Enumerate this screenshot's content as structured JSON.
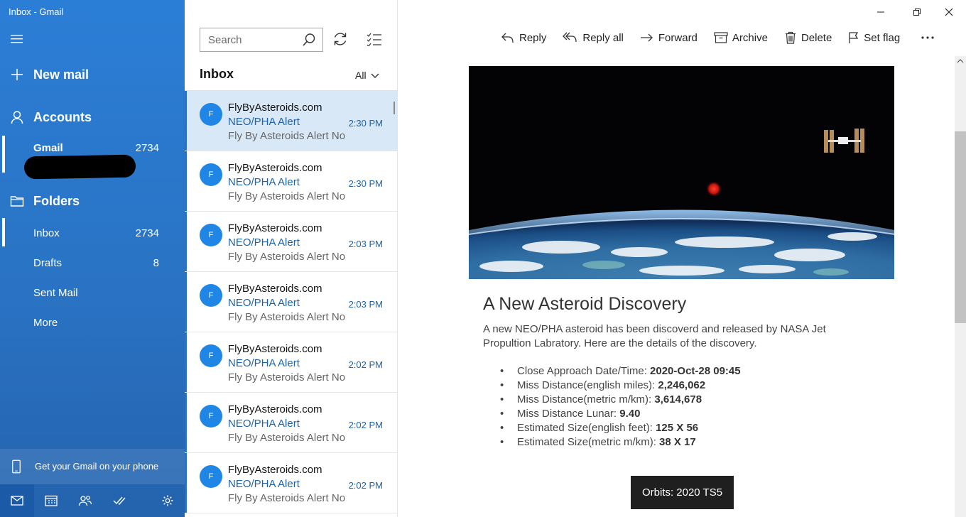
{
  "window": {
    "title": "Inbox - Gmail"
  },
  "nav": {
    "new_mail": "New mail",
    "accounts": "Accounts",
    "account": {
      "name": "Gmail",
      "count": "2734"
    },
    "folders_label": "Folders",
    "folders": [
      {
        "label": "Inbox",
        "count": "2734"
      },
      {
        "label": "Drafts",
        "count": "8"
      },
      {
        "label": "Sent Mail",
        "count": ""
      },
      {
        "label": "More",
        "count": ""
      }
    ],
    "phone_promo": "Get your Gmail on your phone"
  },
  "list": {
    "search_placeholder": "Search",
    "title": "Inbox",
    "filter": "All",
    "messages": [
      {
        "avatar": "F",
        "from": "FlyByAsteroids.com",
        "subject": "NEO/PHA Alert",
        "time": "2:30 PM",
        "preview": "Fly By Asteroids Alert No"
      },
      {
        "avatar": "F",
        "from": "FlyByAsteroids.com",
        "subject": "NEO/PHA Alert",
        "time": "2:30 PM",
        "preview": "Fly By Asteroids Alert No"
      },
      {
        "avatar": "F",
        "from": "FlyByAsteroids.com",
        "subject": "NEO/PHA Alert",
        "time": "2:03 PM",
        "preview": "Fly By Asteroids Alert No"
      },
      {
        "avatar": "F",
        "from": "FlyByAsteroids.com",
        "subject": "NEO/PHA Alert",
        "time": "2:03 PM",
        "preview": "Fly By Asteroids Alert No"
      },
      {
        "avatar": "F",
        "from": "FlyByAsteroids.com",
        "subject": "NEO/PHA Alert",
        "time": "2:02 PM",
        "preview": "Fly By Asteroids Alert No"
      },
      {
        "avatar": "F",
        "from": "FlyByAsteroids.com",
        "subject": "NEO/PHA Alert",
        "time": "2:02 PM",
        "preview": "Fly By Asteroids Alert No"
      },
      {
        "avatar": "F",
        "from": "FlyByAsteroids.com",
        "subject": "NEO/PHA Alert",
        "time": "2:02 PM",
        "preview": "Fly By Asteroids Alert No"
      }
    ]
  },
  "toolbar": {
    "reply": "Reply",
    "reply_all": "Reply all",
    "forward": "Forward",
    "archive": "Archive",
    "delete": "Delete",
    "set_flag": "Set flag",
    "more": "···"
  },
  "email": {
    "heading": "A New Asteroid Discovery",
    "intro": "A new NEO/PHA asteroid has been discoverd and released by NASA Jet Propultion Labratory. Here are the details of the discovery.",
    "details": [
      {
        "label": "Close Approach Date/Time: ",
        "value": "2020-Oct-28 09:45"
      },
      {
        "label": "Miss Distance(english miles): ",
        "value": "2,246,062"
      },
      {
        "label": "Miss Distance(metric m/km): ",
        "value": "3,614,678"
      },
      {
        "label": "Miss Distance Lunar: ",
        "value": "9.40"
      },
      {
        "label": "Estimated Size(english feet): ",
        "value": "125 X 56"
      },
      {
        "label": "Estimated Size(metric m/km): ",
        "value": "38 X 17"
      }
    ],
    "orbits_button": "Orbits: 2020 TS5"
  },
  "colors": {
    "nav_blue": "#2a73c4",
    "accent_link": "#1e63a9",
    "selected_row": "#d9e8f7"
  }
}
